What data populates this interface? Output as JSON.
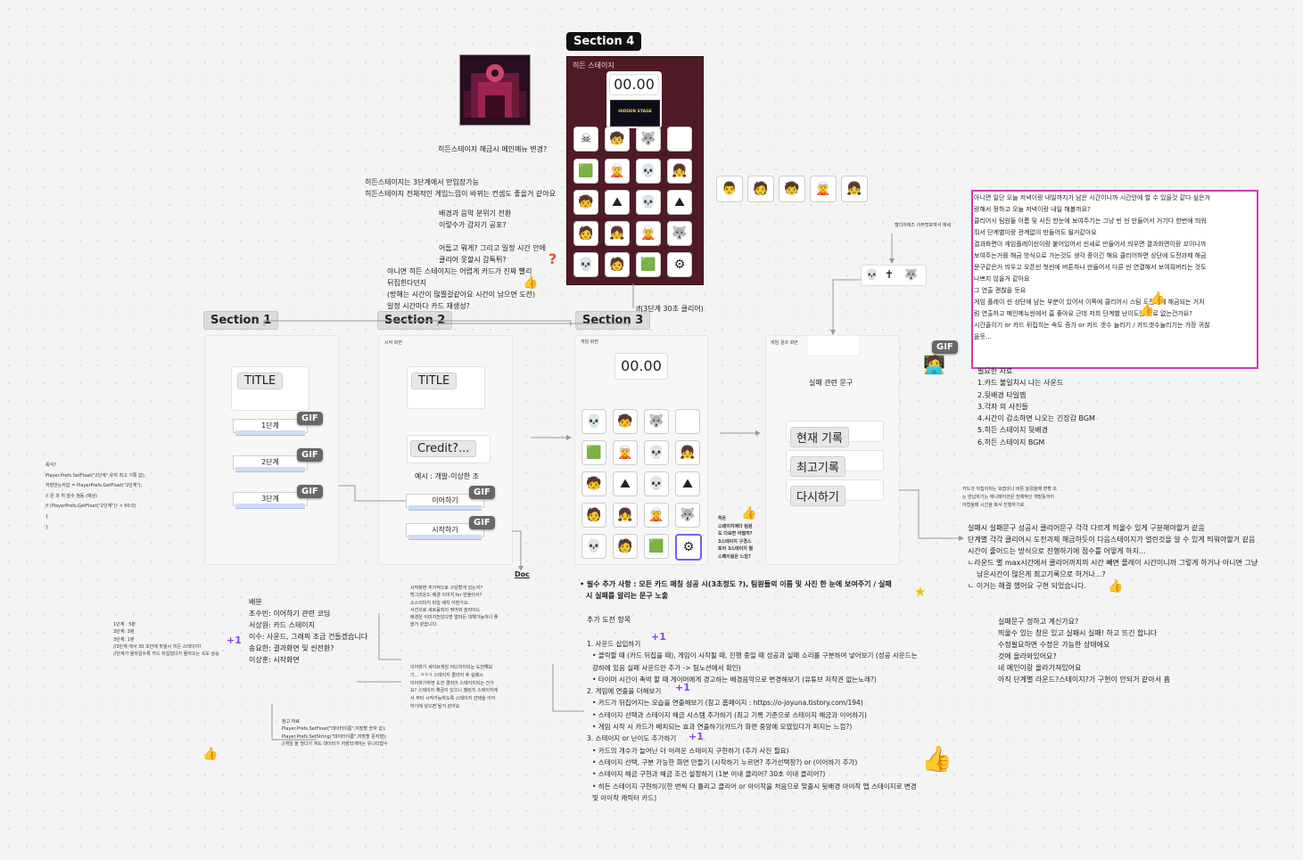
{
  "sections": {
    "s1": "Section 1",
    "s2": "Section 2",
    "s3": "Section 3",
    "s4": "Section 4"
  },
  "hidden_stage": {
    "label": "히든 스테이지",
    "timer": "00.00",
    "banner": "HIDDEN STAGE",
    "condition": "if(3단계 30초 클리어)"
  },
  "frames": {
    "start_screen": "시작 화면",
    "game_screen": "게임 화면",
    "result_screen": "게임 결과 화면"
  },
  "section1": {
    "title": "TITLE",
    "stages": [
      "1단계",
      "2단계",
      "3단계"
    ],
    "gif": "GIF"
  },
  "section2": {
    "title": "TITLE",
    "credit": "Credit?...",
    "example": "예시 : 개발-이상한 조",
    "btn_next": "이어하기",
    "btn_start": "시작하기",
    "gif": "GIF",
    "doc": "Doc"
  },
  "section3": {
    "timer": "00.00"
  },
  "result": {
    "fail_text": "실패 관련 문구",
    "btn_current": "현재 기록",
    "btn_best": "최고기록",
    "btn_retry": "다시하기"
  },
  "notes_top": [
    "히든스테이지 해금시 메인메뉴 변경?",
    "히든스테이지는 3단계에서 만입장가능",
    "히든스테이지 전체적인 게임느낌이 바뀌는 컨셉도 좋을거 같아요",
    "배경과 음악 분위기 전환",
    "이렇수가 갑자기 공포?",
    "어둡고 뭐게? 그리고 일정 시간 안에",
    "클리어 못할시 갑툭튀?",
    "아니면 히든 스테이지는 어렵게 카드가 진짜 빨리",
    "뒤집힌다던지",
    "(방해는 시간이 많찔걸같아요 시간이 남으면 도전)",
    "일정 시간마다 카드 재생성?"
  ],
  "melody_note": "멜디아에즈 너무멋보여서 재세",
  "pink_note": [
    "아니면 일단 오늘 저녁이랑 내일까지가 남은 시간이니까 시간안에 할 수 있을것 같다 싶은거",
    "랑해서 정하고 오늘 저녁이랑 내일 해볼까요?",
    "클리어시 팀원들 이름 및 사진 한눈에 보여주기는 그냥 빈 씬 만들어서 거기다 한번에 띄워",
    "줘서 단계별이랑 관계없이 만들어도 될거같아요",
    "결과화면이 게임플레이씬이랑 붙어있어서 씬새로 만들어서 띄우면 결과화면이랑 꼬이니까",
    "보여주는거를 해금 방식으로 가는것도 생각 중이긴 해요 클리어하면 상단에 도전과제 해금",
    "문구같은거 띄우고 오픈씬 첫씬에 버튼하나 만들어서 다른 씬 연결해서 보여줘버리는 것도",
    "나쁘지 않을거 같아요",
    "그 연출 괜찮을 듯요",
    "게임 플레이 씬 상단에 남는 부분이 있어서 이쪽에 클리어시 스팀 도전과제 해금되는 거처",
    "럼 연출하고 메인메뉴씬에서 흠 좋아요 근데 저희 단계별 난이도는 따로 없는건가요?",
    "시간줄이기 or 카드 뒤집히는 속도 증가 or 카드 갯수 늘리기 / 카드갯수늘리기는 가장 귀찮",
    "을듯..."
  ],
  "needs": [
    "필요한 자료",
    "1.카드 불일치시 나는 사운드",
    "2.뒷배경 타일맵",
    "3.각자 의 사진들",
    "4.시간이 감소하면 나오는 긴장감 BGM",
    "5.히든 스테이지 뒷배경",
    "6.히든 스테이지 BGM"
  ],
  "right_small": [
    "카드가 뒤집어지는 모습이나 버튼 눌렀을때 변할 또",
    "는 반납하기는 애니메이션은 전체적인 개발틀까지",
    "어렵울때 시간을 봐서 진행하기로"
  ],
  "right_mid": [
    "실패시 실패문구 성공시 클리어문구 각각 다르게 띄울수 있게 구분해야할거 같음",
    "단계별 각각 클리어시 도전과제 해금하듯이 다음스테이지가 열린것을 알 수 있게 띄워야할거 같음",
    "시간이 줄어드는 방식으로 진행하기에 점수를 어떻게 하지...",
    "ㄴ라운드 별 max시간에서 클리어까지의 시간 빼면 플레이 시간이니까 그렇게 하거나 아니면 그냥",
    "남은시간이 많은게 최고기록으로 하거나...?",
    "ㄴ 이거는 해결 했어요 구현 되었습니다."
  ],
  "right_low": [
    "실패문구 정하고 계신가요?",
    "띄울수 있는 창은 있고 실패시 실패! 하고 뜨긴 합니다",
    "수정필요하면 수정은 가능한 상태에요",
    "것에 올라와있어요?",
    "네 메인이랑 올라가져있어요",
    "아직 단계별 라운드?스테이지?가 구현이 안되거 같아서 흠"
  ],
  "hidden_side_note": [
    "히든",
    "스테이지에다 팀원",
    "도 다보면 어떨까?",
    "3스테이지 구경스",
    "토어 3스테이지 별",
    "스페이설은 느낌?"
  ],
  "left_code": [
    "폭식?",
    "",
    "Player.Prefs.SetFloat(\"2단계\",유저 최고 기록 값);",
    "",
    "저장안는자값 = PlayerPrefs.GetFloat(\"2단계\");",
    "",
    "// 문 과 히 잘수 첨동 (예상)",
    "if (PlayerPrefs.GetFloat(\"2단계\")? < 60.0)",
    "{",
    "",
    "}"
  ],
  "left_stage_note": [
    "1단계 : 5분",
    "2단계: 3분",
    "3단계: 1분",
    "//3단계 에서 30 초안에 맞을시 히든 스테이지?",
    "//단계가 올라갈수록 카드 뒤집었다가 돌아오는 속도 상승"
  ],
  "roles": [
    "배분",
    "",
    "조수빈: 이어하기 관련 코딩",
    "서상원: 카드 스테이지",
    "이수: 사운드, 그래픽 조금 건들겠습니다",
    "송요한: 결과화면 및 씬전환?",
    "이상훈: 시작화면"
  ],
  "mid_small_notes": [
    "시작화면 추가적으로 구성할게 있는지?",
    "백그라운드 배경 이미지 for 만들어서?",
    "",
    "소스이미지 파일 배치 어떤가요.",
    "",
    "사선으로 세로움직이 뛰어와 슬라이드",
    "",
    "배경은 이미지전있다면 얼마든 대체가능하니 좋",
    "을거 같습니다."
  ],
  "mid_small_notes2": [
    "이어하기 세이브게임 어디까지되는 도전해보",
    "기... ㅋㅋㅋ 스테이지 클리어 후 실패시",
    "이어하기하면 도전 클리어 스테이지되는 건가",
    "요? 스테이지 해금이 있으니 챌린지 스테이지에",
    "서 부터 시작가능하도록 스테이지 선택을 이어",
    "하기에 넣으면 될거 같아요"
  ],
  "ref_note": [
    "참고 자료",
    "",
    "Player.Prefs.SetFloat(\"데이터이름\",저장할 숫자 값);",
    "Player.Prefs.SetString(\"데이터이름\",저장할 문자열);",
    "//게임 을 껏다가 켜도 데이터가 저장되게하는 유니티함수"
  ],
  "required": "필수 추가 사항 : 모든 카드 매칭 성공 시(3초정도 ?), 팀원들의 이름 및 사진 한 눈에 보여주기 / 실패",
  "required2": "시 실패를 알리는 문구 노출",
  "challenge_title": "추가 도전 항목",
  "challenges": [
    "1. 사운드 삽입하기",
    "• 클릭할 때 (카드 뒤집을 때), 게임이 시작될 때, 진행 중일 때 성공과 실패 소리를 구분하여 넣어보기 (성공 사운드는",
    "  강하에 있음 실패 사운드만 추가 -> 팀노션에서 확인)",
    "• 타이머 시간이 촉박 할 때 게이머에게 경고하는 배경음악으로 변경해보기 (유튜브 저작권 없는노래?)",
    "2. 게임에 연출을 더해보기",
    "• 카드가 뒤집어지는 모습을 연출해보기 (참고 홈페이지 : https://o-joyuna.tistory.com/194)",
    "• 스테이지 선택과 스테이지 해금 시스템 추가하기 (최고 기록 기준으로 스테이지 해금과 이어하기)",
    "• 게임 시작 시 카드가 배치되는 효과 연출하기(카드가 화면 중앙에 모였있다가 퍼지는 느낌?)",
    "3. 스테이지 or 난이도 추가하기",
    "• 카드의 개수가 늘어난 더 어려운 스테이지 구현하기 (추가 사진 필요)",
    "• 스테이지 선택, 구분 가능한 화면 만들기 (시작하기 누르면? 추가선택창?) or (이어하기 추가)",
    "• 스테이지 해금 구현과 해금 조건 설정하기 (1분 이내 클리어? 30초 이내 클리어?)",
    "• 히든 스테이지 구현하기(한 번씩 다 틀리고 클리어 or 아이작을 처음으로 맞출시 뒷배경 아이작 맵 스테이지로 변경",
    "  및 아이작 캐릭터 카드)"
  ],
  "gif_label": "GIF",
  "plus_one": "+1",
  "colors": {
    "hidden_bg": "#4e1a26",
    "pink": "#d23ab5",
    "purple": "#8a3ff1",
    "green": "#2c9b3a"
  }
}
